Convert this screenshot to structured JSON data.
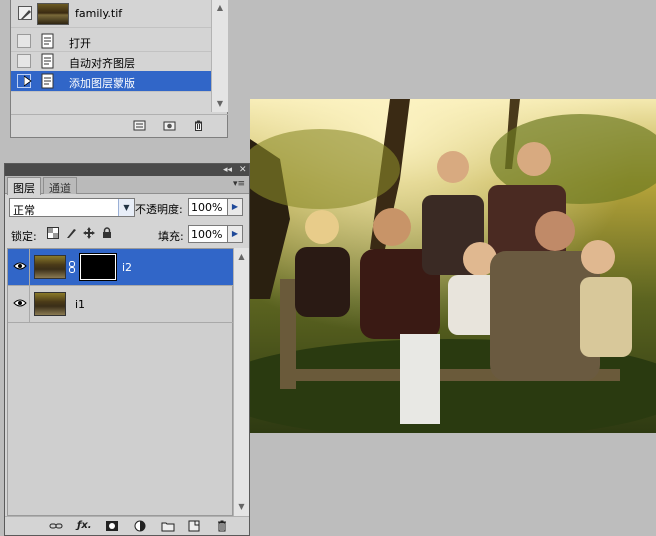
{
  "history": {
    "snapshot_name": "family.tif",
    "items": [
      {
        "label": "打开"
      },
      {
        "label": "自动对齐图层"
      },
      {
        "label": "添加图层蒙版"
      }
    ],
    "selected_index": 2,
    "footer_icons": [
      "new-document-from-state-icon",
      "camera-snapshot-icon",
      "trash-icon"
    ]
  },
  "layers": {
    "tabs": [
      {
        "label": "图层"
      },
      {
        "label": "通道"
      }
    ],
    "blend_mode": "正常",
    "opacity_label": "不透明度:",
    "opacity_value": "100%",
    "lock_label": "锁定:",
    "fill_label": "填充:",
    "fill_value": "100%",
    "items": [
      {
        "name": "i2",
        "has_mask": true,
        "selected": true,
        "visible": true
      },
      {
        "name": "i1",
        "has_mask": false,
        "selected": false,
        "visible": true
      }
    ],
    "footer_icons": [
      "link-icon",
      "fx-icon",
      "mask-icon",
      "adjustment-icon",
      "group-icon",
      "new-layer-icon",
      "trash-icon"
    ]
  },
  "colors": {
    "selection": "#3166c8",
    "panel_bg": "#d4d4d4",
    "workspace_bg": "#bdbdbd"
  }
}
